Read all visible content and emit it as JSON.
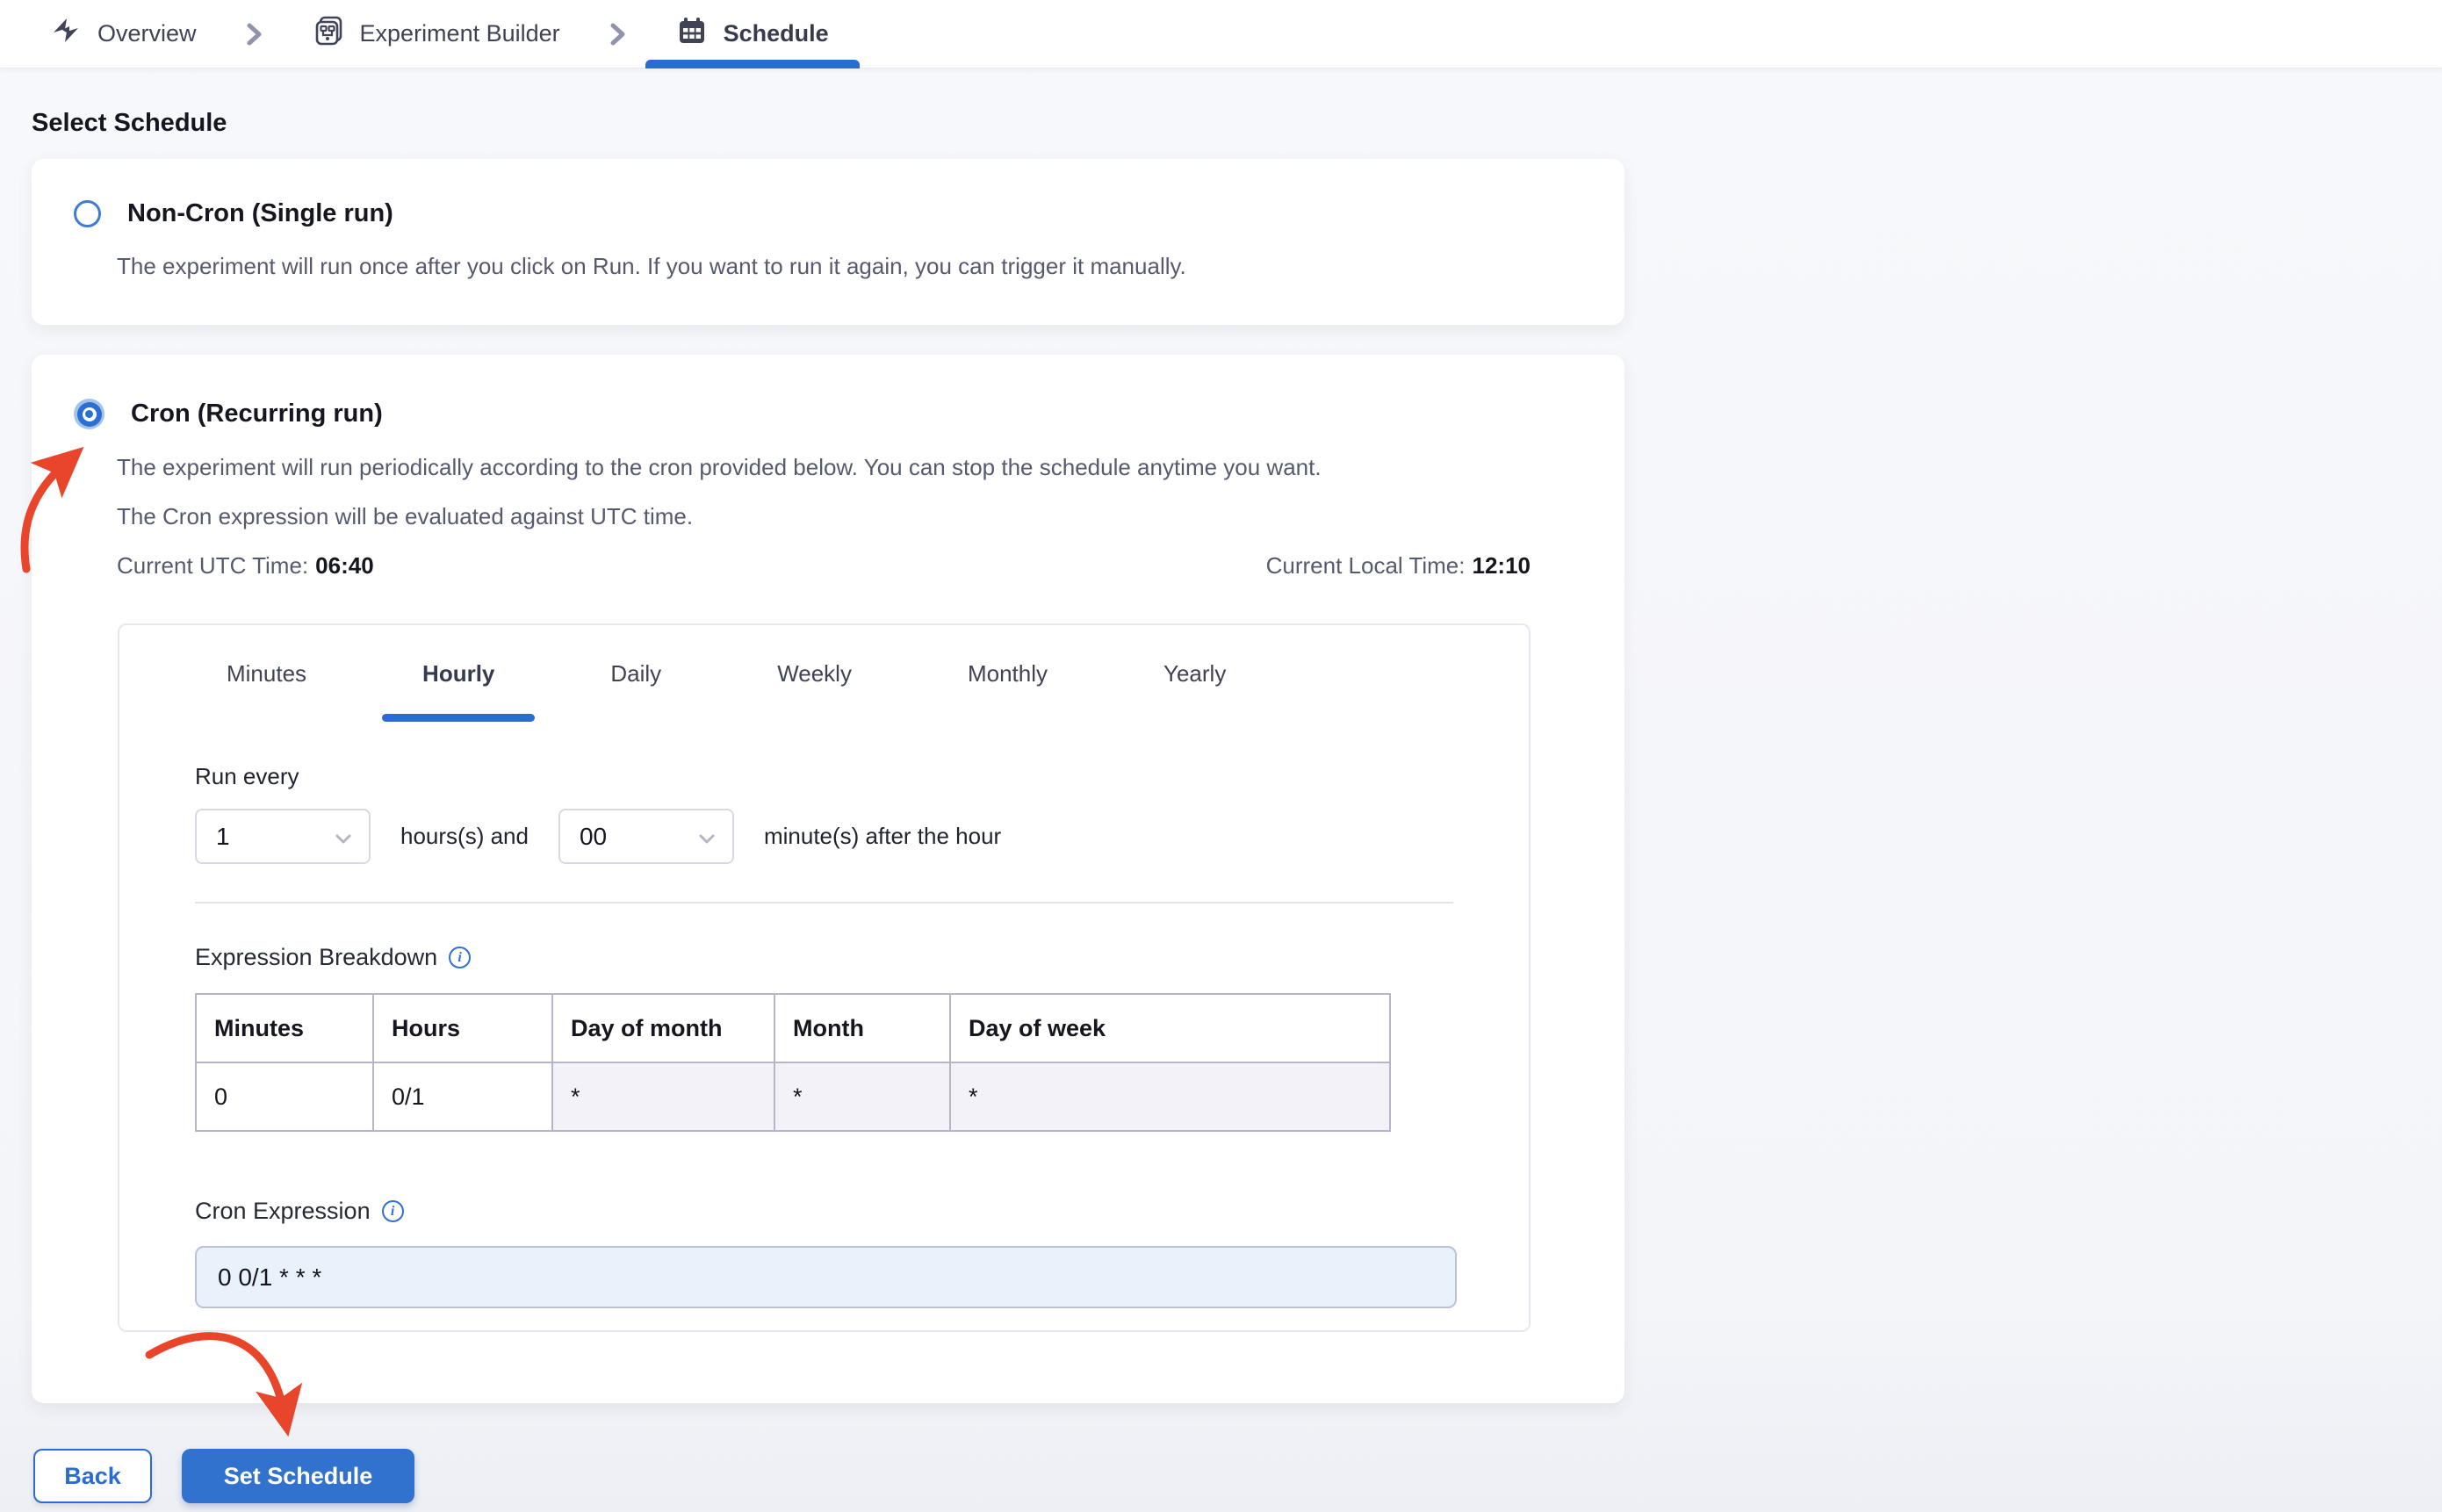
{
  "breadcrumb": {
    "overview": "Overview",
    "experiment_builder": "Experiment Builder",
    "schedule": "Schedule"
  },
  "page": {
    "heading": "Select Schedule"
  },
  "options": {
    "non_cron": {
      "title": "Non-Cron (Single run)",
      "description": "The experiment will run once after you click on Run. If you want to run it again, you can trigger it manually.",
      "selected": false
    },
    "cron": {
      "title": "Cron (Recurring run)",
      "description_line_1": "The experiment will run periodically according to the cron provided below. You can stop the schedule anytime you want.",
      "description_line_2": "The Cron expression will be evaluated against UTC time.",
      "utc_time_label": "Current UTC Time:",
      "utc_time_value": "06:40",
      "local_time_label": "Current Local Time:",
      "local_time_value": "12:10",
      "selected": true
    }
  },
  "scheduler": {
    "tabs": [
      "Minutes",
      "Hourly",
      "Daily",
      "Weekly",
      "Monthly",
      "Yearly"
    ],
    "active_tab": "Hourly",
    "run_every_label": "Run every",
    "hours_select_value": "1",
    "hours_text": "hours(s) and",
    "minutes_select_value": "00",
    "minutes_text": "minute(s) after the hour",
    "expression_breakdown_label": "Expression Breakdown",
    "table": {
      "headers": [
        "Minutes",
        "Hours",
        "Day of month",
        "Month",
        "Day of week"
      ],
      "row": [
        "0",
        "0/1",
        "*",
        "*",
        "*"
      ]
    },
    "cron_expression_label": "Cron Expression",
    "cron_expression_value": "0 0/1 * * *"
  },
  "footer": {
    "back_label": "Back",
    "submit_label": "Set Schedule"
  },
  "colors": {
    "accent_blue": "#2b6bd3",
    "annotation_red": "#e8452a",
    "cron_input_bg": "#e9f2fb",
    "table_highlight_bg": "#f2f2f8",
    "text_dark": "#15161f",
    "text_slate": "#555a6e"
  }
}
